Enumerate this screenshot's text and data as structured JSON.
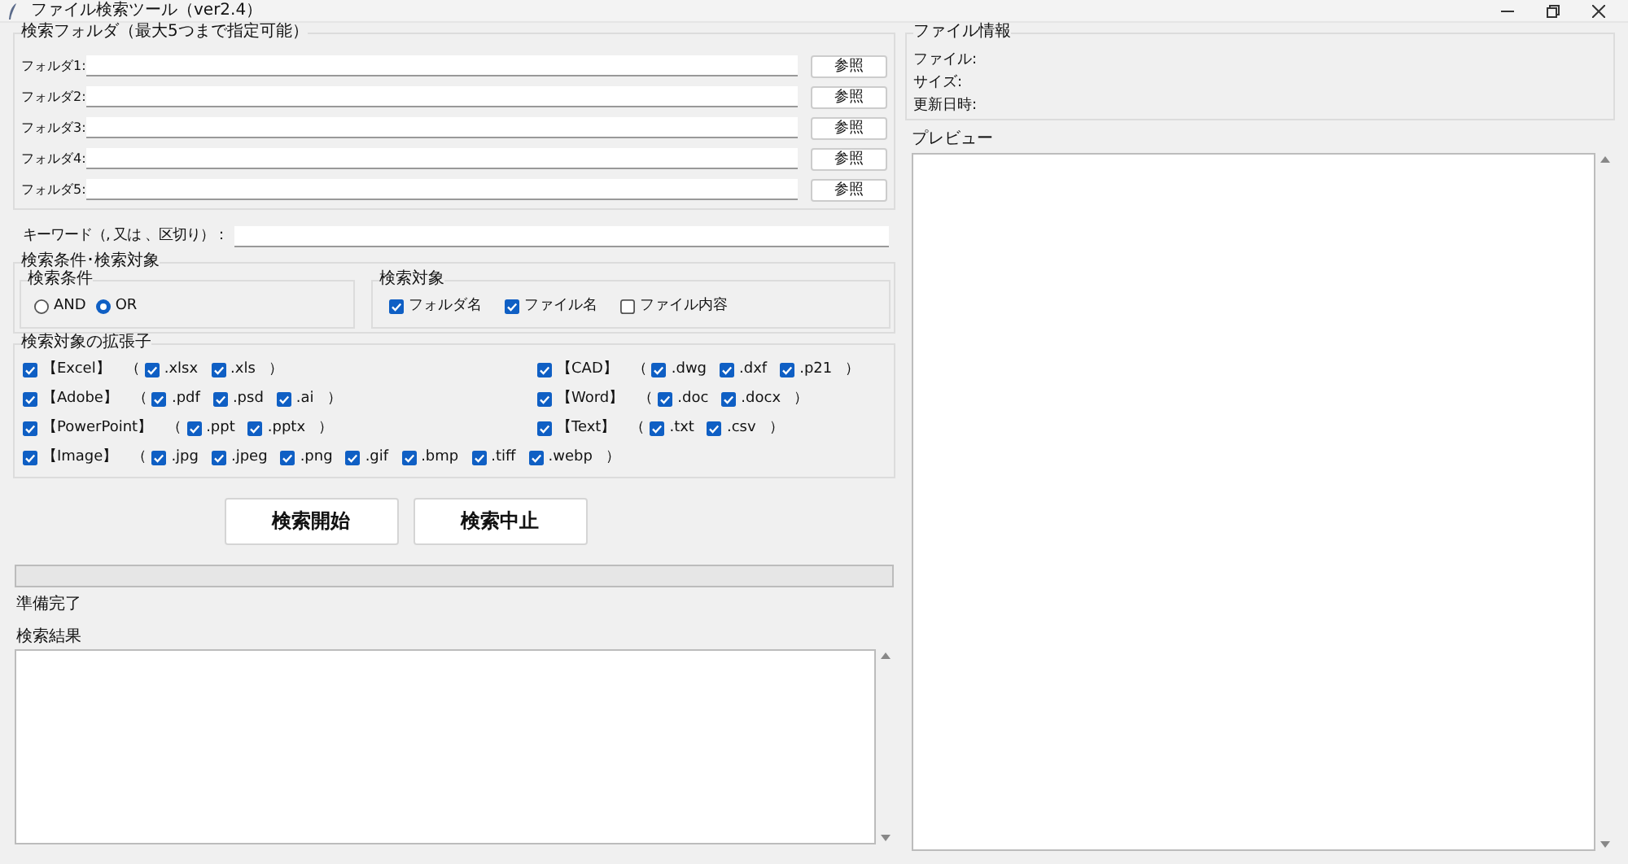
{
  "window": {
    "title": "ファイル検索ツール（ver2.4）"
  },
  "folders": {
    "title": "検索フォルダ（最大5つまで指定可能）",
    "rows": [
      {
        "label": "フォルダ1:",
        "button": "参照"
      },
      {
        "label": "フォルダ2:",
        "button": "参照"
      },
      {
        "label": "フォルダ3:",
        "button": "参照"
      },
      {
        "label": "フォルダ4:",
        "button": "参照"
      },
      {
        "label": "フォルダ5:",
        "button": "参照"
      }
    ]
  },
  "keyword": {
    "label": "キーワード（, 又は 、区切り）："
  },
  "criteria": {
    "title": "検索条件･検索対象",
    "condition": {
      "title": "検索条件",
      "options": [
        {
          "label": "AND",
          "selected": false
        },
        {
          "label": "OR",
          "selected": true
        }
      ]
    },
    "target": {
      "title": "検索対象",
      "options": [
        {
          "label": "フォルダ名",
          "checked": true
        },
        {
          "label": "ファイル名",
          "checked": true
        },
        {
          "label": "ファイル内容",
          "checked": false
        }
      ]
    }
  },
  "extensions": {
    "title": "検索対象の拡張子",
    "left": [
      {
        "label": "【Excel】",
        "checked": true,
        "open": "（",
        "close": "）",
        "items": [
          {
            "label": ".xlsx",
            "checked": true
          },
          {
            "label": ".xls",
            "checked": true
          }
        ]
      },
      {
        "label": "【Adobe】",
        "checked": true,
        "open": "（",
        "close": "）",
        "items": [
          {
            "label": ".pdf",
            "checked": true
          },
          {
            "label": ".psd",
            "checked": true
          },
          {
            "label": ".ai",
            "checked": true
          }
        ]
      },
      {
        "label": "【PowerPoint】",
        "checked": true,
        "open": "（",
        "close": "）",
        "items": [
          {
            "label": ".ppt",
            "checked": true
          },
          {
            "label": ".pptx",
            "checked": true
          }
        ]
      },
      {
        "label": "【Image】",
        "checked": true,
        "open": "（",
        "close": "）",
        "items": [
          {
            "label": ".jpg",
            "checked": true
          },
          {
            "label": ".jpeg",
            "checked": true
          },
          {
            "label": ".png",
            "checked": true
          },
          {
            "label": ".gif",
            "checked": true
          },
          {
            "label": ".bmp",
            "checked": true
          },
          {
            "label": ".tiff",
            "checked": true
          },
          {
            "label": ".webp",
            "checked": true
          }
        ]
      }
    ],
    "right": [
      {
        "label": "【CAD】",
        "checked": true,
        "open": "（",
        "close": "）",
        "items": [
          {
            "label": ".dwg",
            "checked": true
          },
          {
            "label": ".dxf",
            "checked": true
          },
          {
            "label": ".p21",
            "checked": true
          }
        ]
      },
      {
        "label": "【Word】",
        "checked": true,
        "open": "（",
        "close": "）",
        "items": [
          {
            "label": ".doc",
            "checked": true
          },
          {
            "label": ".docx",
            "checked": true
          }
        ]
      },
      {
        "label": "【Text】",
        "checked": true,
        "open": "（",
        "close": "）",
        "items": [
          {
            "label": ".txt",
            "checked": true
          },
          {
            "label": ".csv",
            "checked": true
          }
        ]
      }
    ]
  },
  "buttons": [
    "検索開始",
    "検索中止"
  ],
  "progress": {
    "level": 0
  },
  "status": "準備完了",
  "results": {
    "title": "検索結果"
  },
  "file_info": {
    "title": "ファイル情報",
    "fields": [
      "ファイル:",
      "サイズ:",
      "更新日時:"
    ]
  },
  "preview": {
    "title": "プレビュー"
  }
}
